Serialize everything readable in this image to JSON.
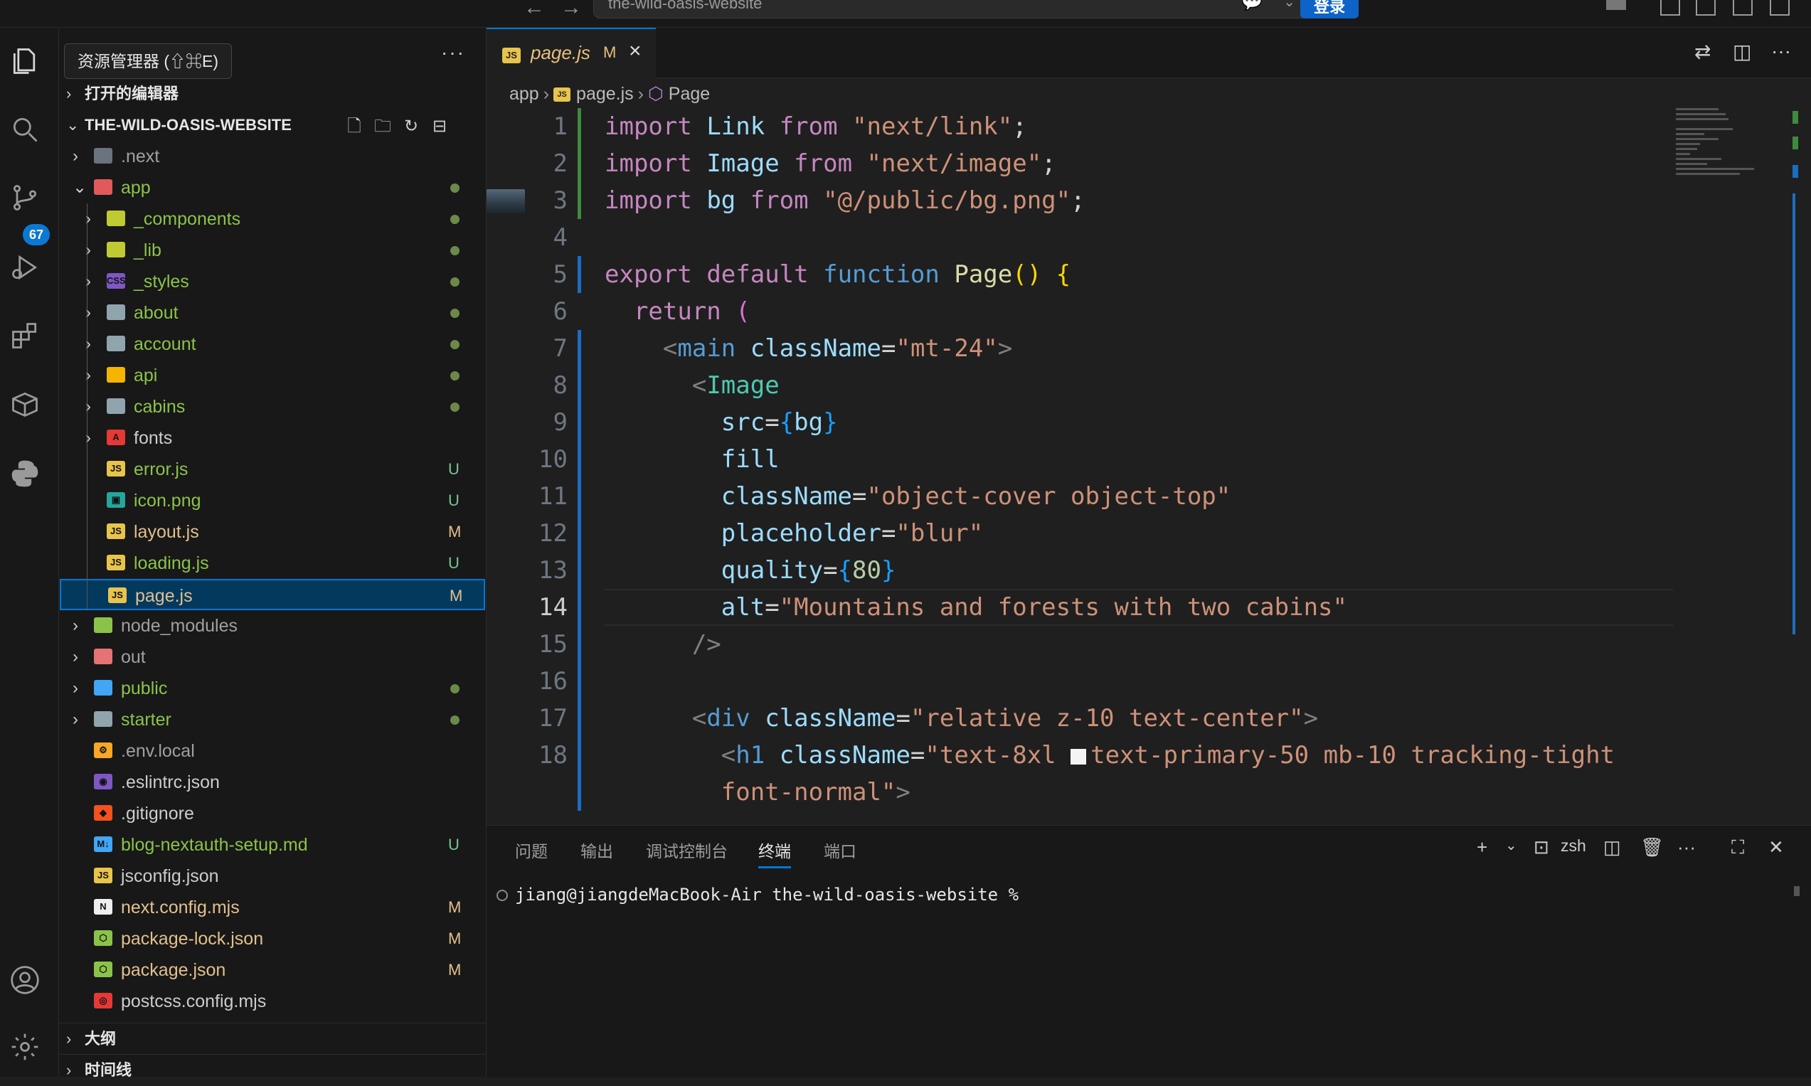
{
  "titlebar": {
    "search_text": "the-wild-oasis-website",
    "login_label": "登录",
    "back_icon": "arrow-left-icon",
    "forward_icon": "arrow-right-icon"
  },
  "activity_bar": {
    "items": [
      "explorer-icon",
      "search-icon",
      "source-control-icon",
      "run-debug-icon",
      "extensions-icon",
      "remote-explorer-icon",
      "python-icon"
    ],
    "source_control_badge": "67",
    "bottom": [
      "account-icon",
      "settings-gear-icon"
    ]
  },
  "sidebar": {
    "tooltip": "资源管理器 (⇧⌘E)",
    "more": "···",
    "open_editors_label": "打开的编辑器",
    "project_label": "THE-WILD-OASIS-WEBSITE",
    "outline_label": "大纲",
    "timeline_label": "时间线",
    "tree": [
      {
        "name": ".next",
        "type": "folder",
        "level": 0,
        "expanded": false,
        "status": "",
        "color": "#a0a0a0",
        "icon_color": "#6b7280",
        "icon_text": ""
      },
      {
        "name": "app",
        "type": "folder",
        "level": 0,
        "expanded": true,
        "status": "dot",
        "color": "#8bc34a",
        "icon_color": "#e05a5a",
        "icon_text": ""
      },
      {
        "name": "_components",
        "type": "folder",
        "level": 1,
        "expanded": false,
        "status": "dot",
        "color": "#8bc34a",
        "icon_color": "#c0ca33",
        "icon_text": ""
      },
      {
        "name": "_lib",
        "type": "folder",
        "level": 1,
        "expanded": false,
        "status": "dot",
        "color": "#8bc34a",
        "icon_color": "#c0ca33",
        "icon_text": ""
      },
      {
        "name": "_styles",
        "type": "folder",
        "level": 1,
        "expanded": false,
        "status": "dot",
        "color": "#8bc34a",
        "icon_color": "#7e57c2",
        "icon_text": "CSS"
      },
      {
        "name": "about",
        "type": "folder",
        "level": 1,
        "expanded": false,
        "status": "dot",
        "color": "#8bc34a",
        "icon_color": "#90a4ae",
        "icon_text": ""
      },
      {
        "name": "account",
        "type": "folder",
        "level": 1,
        "expanded": false,
        "status": "dot",
        "color": "#8bc34a",
        "icon_color": "#90a4ae",
        "icon_text": ""
      },
      {
        "name": "api",
        "type": "folder",
        "level": 1,
        "expanded": false,
        "status": "dot",
        "color": "#8bc34a",
        "icon_color": "#f4b400",
        "icon_text": ""
      },
      {
        "name": "cabins",
        "type": "folder",
        "level": 1,
        "expanded": false,
        "status": "dot",
        "color": "#8bc34a",
        "icon_color": "#90a4ae",
        "icon_text": ""
      },
      {
        "name": "fonts",
        "type": "folder",
        "level": 1,
        "expanded": false,
        "status": "",
        "color": "#cccccc",
        "icon_color": "#e53935",
        "icon_text": "A"
      },
      {
        "name": "error.js",
        "type": "file",
        "level": 1,
        "status": "U",
        "color": "#8bc34a",
        "icon_color": "#e8c44c",
        "icon_text": "JS"
      },
      {
        "name": "icon.png",
        "type": "file",
        "level": 1,
        "status": "U",
        "color": "#8bc34a",
        "icon_color": "#26a69a",
        "icon_text": "▣"
      },
      {
        "name": "layout.js",
        "type": "file",
        "level": 1,
        "status": "M",
        "color": "#e2c08d",
        "icon_color": "#e8c44c",
        "icon_text": "JS"
      },
      {
        "name": "loading.js",
        "type": "file",
        "level": 1,
        "status": "U",
        "color": "#8bc34a",
        "icon_color": "#e8c44c",
        "icon_text": "JS"
      },
      {
        "name": "page.js",
        "type": "file",
        "level": 1,
        "status": "M",
        "color": "#e2c08d",
        "icon_color": "#e8c44c",
        "icon_text": "JS",
        "selected": true
      },
      {
        "name": "node_modules",
        "type": "folder",
        "level": 0,
        "expanded": false,
        "status": "",
        "color": "#a0a0a0",
        "icon_color": "#8bc34a",
        "icon_text": ""
      },
      {
        "name": "out",
        "type": "folder",
        "level": 0,
        "expanded": false,
        "status": "",
        "color": "#a0a0a0",
        "icon_color": "#e57373",
        "icon_text": ""
      },
      {
        "name": "public",
        "type": "folder",
        "level": 0,
        "expanded": false,
        "status": "dot",
        "color": "#8bc34a",
        "icon_color": "#42a5f5",
        "icon_text": ""
      },
      {
        "name": "starter",
        "type": "folder",
        "level": 0,
        "expanded": false,
        "status": "dot",
        "color": "#8bc34a",
        "icon_color": "#90a4ae",
        "icon_text": ""
      },
      {
        "name": ".env.local",
        "type": "file",
        "level": 0,
        "status": "",
        "color": "#a0a0a0",
        "icon_color": "#f9a825",
        "icon_text": "⚙"
      },
      {
        "name": ".eslintrc.json",
        "type": "file",
        "level": 0,
        "status": "",
        "color": "#cccccc",
        "icon_color": "#7e57c2",
        "icon_text": "◉"
      },
      {
        "name": ".gitignore",
        "type": "file",
        "level": 0,
        "status": "",
        "color": "#cccccc",
        "icon_color": "#f4511e",
        "icon_text": "◆"
      },
      {
        "name": "blog-nextauth-setup.md",
        "type": "file",
        "level": 0,
        "status": "U",
        "color": "#8bc34a",
        "icon_color": "#42a5f5",
        "icon_text": "M↓"
      },
      {
        "name": "jsconfig.json",
        "type": "file",
        "level": 0,
        "status": "",
        "color": "#cccccc",
        "icon_color": "#e8c44c",
        "icon_text": "JS"
      },
      {
        "name": "next.config.mjs",
        "type": "file",
        "level": 0,
        "status": "M",
        "color": "#e2c08d",
        "icon_color": "#eeeeee",
        "icon_text": "N"
      },
      {
        "name": "package-lock.json",
        "type": "file",
        "level": 0,
        "status": "M",
        "color": "#e2c08d",
        "icon_color": "#8bc34a",
        "icon_text": "⬡"
      },
      {
        "name": "package.json",
        "type": "file",
        "level": 0,
        "status": "M",
        "color": "#e2c08d",
        "icon_color": "#8bc34a",
        "icon_text": "⬡"
      },
      {
        "name": "postcss.config.mjs",
        "type": "file",
        "level": 0,
        "status": "",
        "color": "#cccccc",
        "icon_color": "#e53935",
        "icon_text": "◎"
      }
    ]
  },
  "editor": {
    "tab": {
      "name": "page.js",
      "modified": "M",
      "icon": "JS"
    },
    "breadcrumb": [
      "app",
      "page.js",
      "Page"
    ],
    "current_line": 14,
    "lines": [
      {
        "n": "1",
        "html": "<span class='kw'>import</span> <span class='id'>Link</span> <span class='kw'>from</span> <span class='str'>\"next/link\"</span><span class='txt'>;</span>"
      },
      {
        "n": "2",
        "html": "<span class='kw'>import</span> <span class='id'>Image</span> <span class='kw'>from</span> <span class='str'>\"next/image\"</span><span class='txt'>;</span>"
      },
      {
        "n": "3",
        "html": "<span class='kw'>import</span> <span class='id'>bg</span> <span class='kw'>from</span> <span class='str'>\"@/public/bg.png\"</span><span class='txt'>;</span>"
      },
      {
        "n": "4",
        "html": ""
      },
      {
        "n": "5",
        "html": "<span class='kw'>export</span> <span class='kw'>default</span> <span class='kw2'>function</span> <span class='fn'>Page</span><span class='br'>()</span> <span class='br'>{</span>"
      },
      {
        "n": "6",
        "html": "  <span class='kw'>return</span> <span class='br3'>(</span>"
      },
      {
        "n": "7",
        "html": "    <span class='pn'>&lt;</span><span class='kw2'>main</span> <span class='id'>className</span><span class='txt'>=</span><span class='str'>\"mt-24\"</span><span class='pn'>&gt;</span>"
      },
      {
        "n": "8",
        "html": "      <span class='pn'>&lt;</span><span class='tag'>Image</span>"
      },
      {
        "n": "9",
        "html": "        <span class='id'>src</span><span class='txt'>=</span><span class='br2'>{</span><span class='id'>bg</span><span class='br2'>}</span>"
      },
      {
        "n": "10",
        "html": "        <span class='id'>fill</span>"
      },
      {
        "n": "11",
        "html": "        <span class='id'>className</span><span class='txt'>=</span><span class='str'>\"object-cover object-top\"</span>"
      },
      {
        "n": "12",
        "html": "        <span class='id'>placeholder</span><span class='txt'>=</span><span class='str'>\"blur\"</span>"
      },
      {
        "n": "13",
        "html": "        <span class='id'>quality</span><span class='txt'>=</span><span class='br2'>{</span><span class='num'>80</span><span class='br2'>}</span>"
      },
      {
        "n": "14",
        "html": "        <span class='id'>alt</span><span class='txt'>=</span><span class='str'>\"Mountains and forests with two cabins\"</span>"
      },
      {
        "n": "15",
        "html": "      <span class='pn'>/&gt;</span>"
      },
      {
        "n": "16",
        "html": ""
      },
      {
        "n": "17",
        "html": "      <span class='pn'>&lt;</span><span class='kw2'>div</span> <span class='id'>className</span><span class='txt'>=</span><span class='str'>\"relative z-10 text-center\"</span><span class='pn'>&gt;</span>"
      },
      {
        "n": "18",
        "html": "        <span class='pn'>&lt;</span><span class='kw2'>h1</span> <span class='id'>className</span><span class='txt'>=</span><span class='str'>\"text-8xl </span><span style='display:inline-block;width:22px;height:22px;background:#f4f4f4;vertical-align:-2px;margin-right:6px'></span><span class='str'>text-primary-50 mb-10 tracking-tight</span>"
      },
      {
        "n": "",
        "html": "        <span class='str'>font-normal\"</span><span class='pn'>&gt;</span>"
      }
    ]
  },
  "panel": {
    "tabs": [
      "问题",
      "输出",
      "调试控制台",
      "终端",
      "端口"
    ],
    "active_tab": "终端",
    "shell": "zsh",
    "terminal_prompt": "jiang@jiangdeMacBook-Air the-wild-oasis-website %"
  }
}
